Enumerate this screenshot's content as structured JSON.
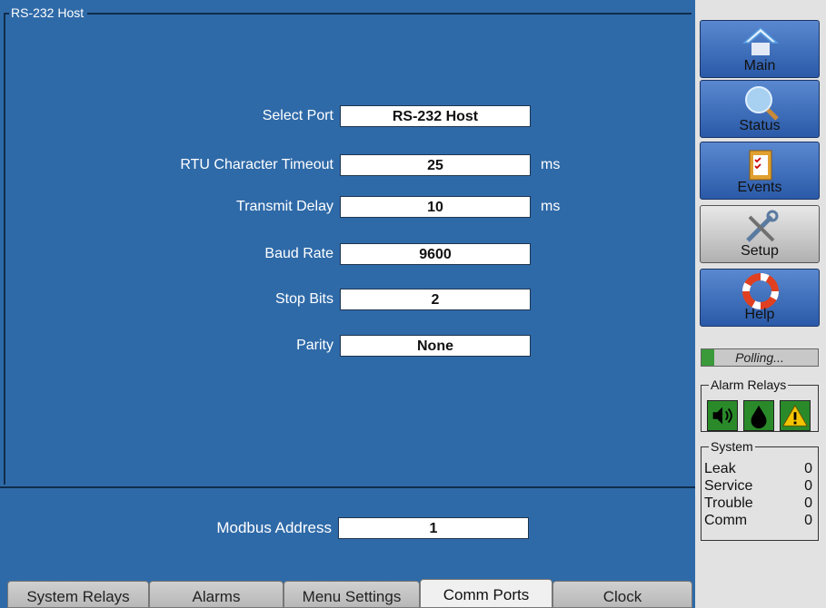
{
  "panel": {
    "group_title": "RS-232 Host",
    "fields": [
      {
        "label": "Select Port",
        "value": "RS-232 Host",
        "unit": ""
      },
      {
        "label": "RTU Character Timeout",
        "value": "25",
        "unit": "ms"
      },
      {
        "label": "Transmit Delay",
        "value": "10",
        "unit": "ms"
      },
      {
        "label": "Baud Rate",
        "value": "9600",
        "unit": ""
      },
      {
        "label": "Stop Bits",
        "value": "2",
        "unit": ""
      },
      {
        "label": "Parity",
        "value": "None",
        "unit": ""
      }
    ],
    "modbus": {
      "label": "Modbus Address",
      "value": "1"
    }
  },
  "tabs": [
    {
      "label": "System Relays",
      "active": false
    },
    {
      "label": "Alarms",
      "active": false
    },
    {
      "label": "Menu Settings",
      "active": false
    },
    {
      "label": "Comm Ports",
      "active": true
    },
    {
      "label": "Clock",
      "active": false
    }
  ],
  "sidebar": {
    "nav": [
      {
        "label": "Main",
        "icon": "home-icon"
      },
      {
        "label": "Status",
        "icon": "magnifier-icon"
      },
      {
        "label": "Events",
        "icon": "clipboard-icon"
      },
      {
        "label": "Setup",
        "icon": "tools-icon",
        "active": true
      },
      {
        "label": "Help",
        "icon": "lifebuoy-icon"
      }
    ],
    "status_text": "Polling...",
    "alarm_relays": {
      "title": "Alarm Relays",
      "icons": [
        "speaker-icon",
        "drop-icon",
        "warning-icon"
      ]
    },
    "system": {
      "title": "System",
      "rows": [
        {
          "label": "Leak",
          "value": "0"
        },
        {
          "label": "Service",
          "value": "0"
        },
        {
          "label": "Trouble",
          "value": "0"
        },
        {
          "label": "Comm",
          "value": "0"
        }
      ]
    }
  },
  "colors": {
    "panel_bg": "#2f6aa8",
    "nav_button": "#3a6ab8",
    "relay_green": "#2a8a2a",
    "warning_yellow": "#f2c400"
  }
}
